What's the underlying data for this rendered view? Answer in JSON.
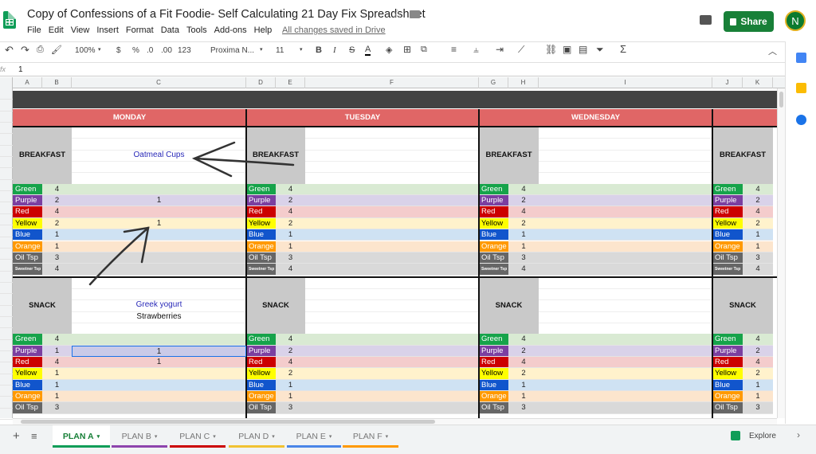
{
  "header": {
    "title": "Copy of Confessions of a Fit Foodie- Self Calculating 21 Day Fix Spreadsheet",
    "menu": [
      "File",
      "Edit",
      "View",
      "Insert",
      "Format",
      "Data",
      "Tools",
      "Add-ons",
      "Help"
    ],
    "saved": "All changes saved in Drive",
    "share": "Share",
    "avatar": "N"
  },
  "toolbar": {
    "zoom": "100%",
    "currency": "$",
    "percent": "%",
    "dec_less": ".0",
    "dec_more": ".00",
    "format": "123",
    "font": "Proxima N...",
    "size": "11",
    "bold": "B",
    "italic": "I",
    "strike": "S",
    "text_color": "A"
  },
  "formula_bar": {
    "fx": "fx",
    "value": "1"
  },
  "columns": [
    "A",
    "B",
    "C",
    "D",
    "E",
    "F",
    "G",
    "H",
    "I",
    "J",
    "K"
  ],
  "days": [
    "MONDAY",
    "TUESDAY",
    "WEDNESDAY"
  ],
  "meals": {
    "breakfast": "BREAKFAST",
    "snack": "SNACK"
  },
  "monday": {
    "breakfast_item": "Oatmeal Cups",
    "snack_item_1": "Greek yogurt",
    "snack_item_2": "Strawberries",
    "breakfast_purple": "1",
    "breakfast_yellow": "1",
    "snack_purple": "1",
    "snack_red": "1"
  },
  "containers": [
    {
      "label": "Green",
      "color": "#16a34a",
      "text": "#fff",
      "row": "#d9ead3"
    },
    {
      "label": "Purple",
      "color": "#7b3fa0",
      "text": "#fff",
      "row": "#d9d2e9"
    },
    {
      "label": "Red",
      "color": "#cc0000",
      "text": "#fff",
      "row": "#f4cccc"
    },
    {
      "label": "Yellow",
      "color": "#ffff00",
      "text": "#000",
      "row": "#fff2cc"
    },
    {
      "label": "Blue",
      "color": "#1155cc",
      "text": "#fff",
      "row": "#cfe2f3"
    },
    {
      "label": "Orange",
      "color": "#ff9900",
      "text": "#fff",
      "row": "#fce5cd"
    },
    {
      "label": "Oil Tsp",
      "color": "#666666",
      "text": "#fff",
      "row": "#d9d9d9"
    },
    {
      "label": "Sweetner Tsp",
      "color": "#666666",
      "text": "#fff",
      "row": "#d9d9d9"
    }
  ],
  "breakfast_counts": {
    "monday": [
      "4",
      "2",
      "4",
      "2",
      "1",
      "1",
      "3",
      "4"
    ],
    "tuesday": [
      "4",
      "2",
      "4",
      "2",
      "1",
      "1",
      "3",
      "4"
    ],
    "wednesday": [
      "4",
      "2",
      "4",
      "2",
      "1",
      "1",
      "3",
      "4"
    ],
    "thursday": [
      "4",
      "2",
      "4",
      "2",
      "1",
      "1",
      "3",
      "4"
    ]
  },
  "snack_counts": {
    "monday": [
      "4",
      "1",
      "4",
      "1",
      "1",
      "1",
      "3"
    ],
    "tuesday": [
      "4",
      "2",
      "4",
      "2",
      "1",
      "1",
      "3"
    ],
    "wednesday": [
      "4",
      "2",
      "4",
      "2",
      "1",
      "1",
      "3"
    ],
    "thursday": [
      "4",
      "2",
      "4",
      "2",
      "1",
      "1",
      "3"
    ]
  },
  "sheet_tabs": [
    {
      "label": "PLAN A",
      "color": "#0f9d58",
      "active": true
    },
    {
      "label": "PLAN B",
      "color": "#8e44ad",
      "active": false
    },
    {
      "label": "PLAN C",
      "color": "#cc0000",
      "active": false
    },
    {
      "label": "PLAN D",
      "color": "#f1c232",
      "active": false
    },
    {
      "label": "PLAN E",
      "color": "#4a86e8",
      "active": false
    },
    {
      "label": "PLAN F",
      "color": "#ff9900",
      "active": false
    }
  ],
  "explore": "Explore",
  "colors": {
    "day_header": "#e06666",
    "meal_cell": "#c9c9c9",
    "dark_band": "#434343",
    "selection": "#1a73e8"
  }
}
